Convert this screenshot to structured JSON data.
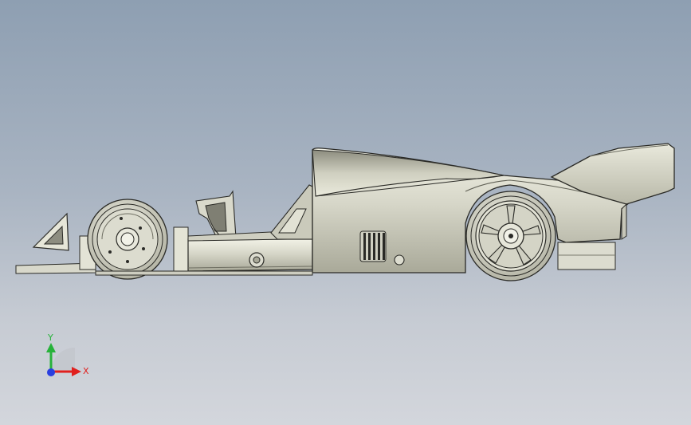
{
  "viewport": {
    "model": "race-car-side-view",
    "colors": {
      "bg_top": "#8e9fb2",
      "bg_bottom": "#d3d6dc",
      "body_light": "#dcdccf",
      "body_mid": "#bdbdae",
      "body_dark": "#8a8a7c",
      "outline": "#2a2a26"
    }
  },
  "triad": {
    "x_label": "X",
    "y_label": "Y",
    "x_color": "#e0201e",
    "y_color": "#27b23a",
    "z_color": "#2a3fe0"
  }
}
